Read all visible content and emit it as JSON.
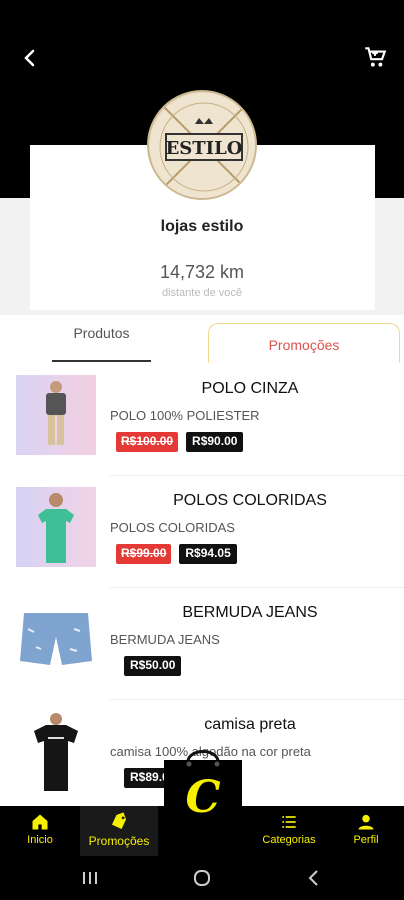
{
  "header": {
    "back_icon": "arrow-back-icon",
    "cart_icon": "shopping-cart-icon"
  },
  "store": {
    "logo_text": "ESTILO",
    "name": "lojas estilo",
    "distance": "14,732 km",
    "distance_label": "distante de você"
  },
  "tabs": {
    "produtos": "Produtos",
    "promocoes": "Promoções"
  },
  "products": [
    {
      "title": "POLO CINZA",
      "desc": "POLO 100% POLIESTER",
      "old_price": "R$100.00",
      "new_price": "R$90.00"
    },
    {
      "title": "POLOS COLORIDAS",
      "desc": "POLOS COLORIDAS",
      "old_price": "R$99.00",
      "new_price": "R$94.05"
    },
    {
      "title": "BERMUDA JEANS",
      "desc": "BERMUDA JEANS",
      "old_price": "",
      "new_price": "R$50.00"
    },
    {
      "title": "camisa preta",
      "desc": "camisa 100% algodão na cor preta",
      "old_price": "",
      "new_price": "R$89.00"
    }
  ],
  "bottom_nav": {
    "inicio": "Inicio",
    "promocoes": "Promoções",
    "categorias": "Categorias",
    "perfil": "Perfil"
  },
  "fab": {
    "letter": "C"
  },
  "colors": {
    "accent": "#f7ef00",
    "sale": "#e53935",
    "tab_border": "#f3d98a"
  }
}
